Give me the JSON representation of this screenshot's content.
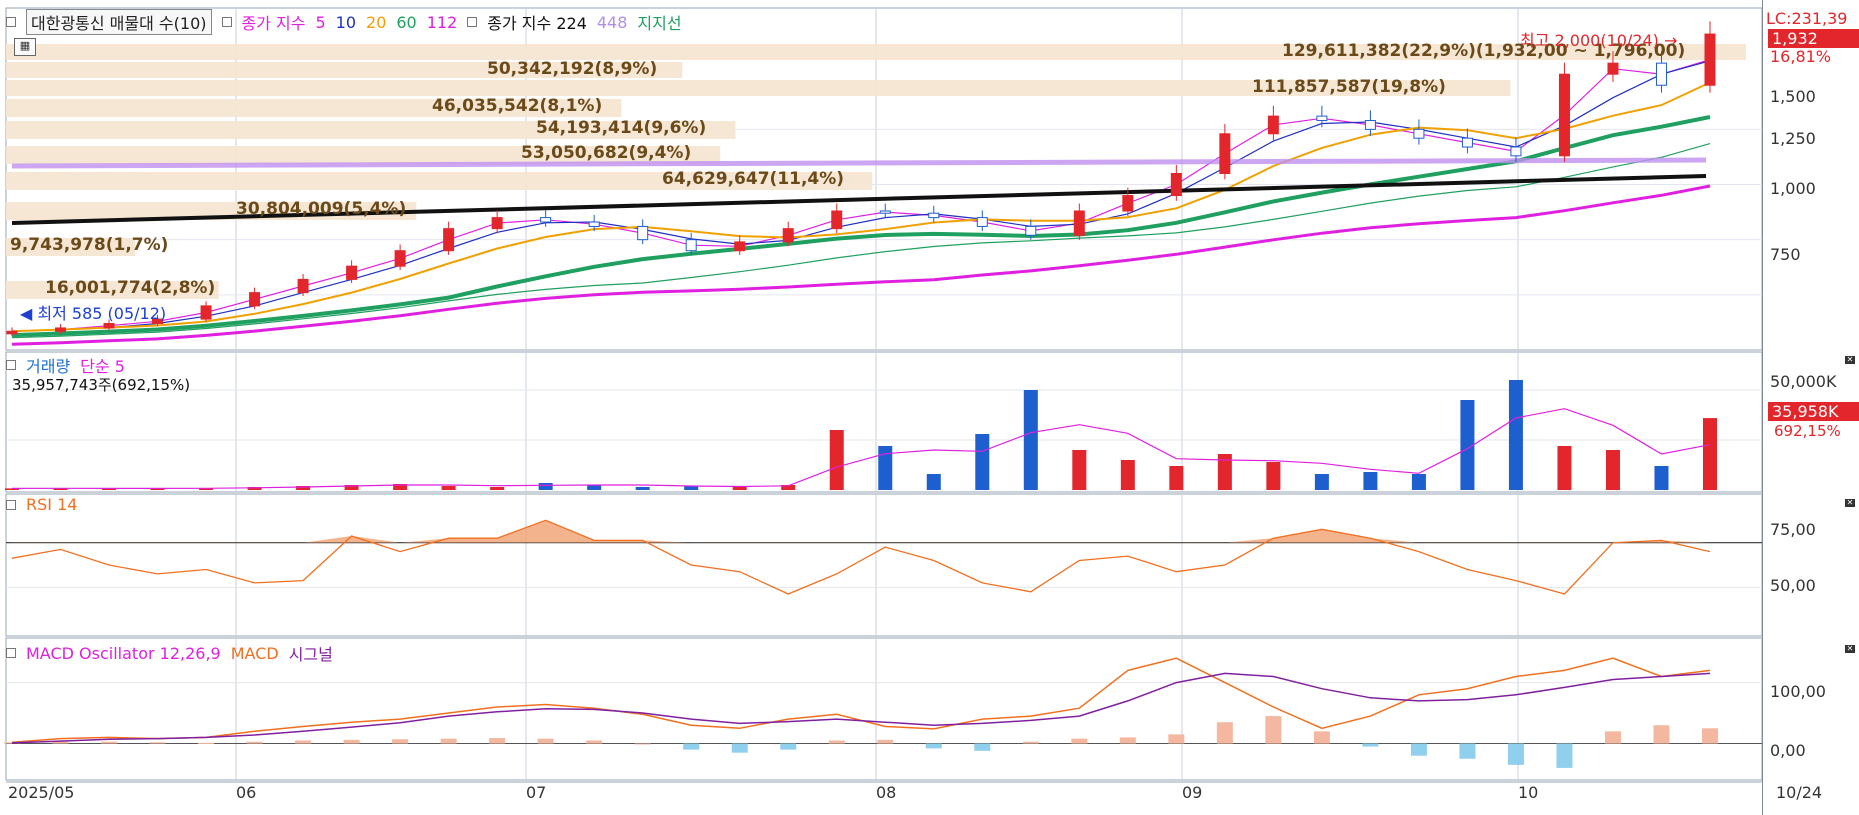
{
  "price_panel": {
    "legend": {
      "title": "대한광통신 매물대 수(10)",
      "ma_label": "종가 지수",
      "ma_periods": [
        "5",
        "10",
        "20",
        "60",
        "112"
      ],
      "ma_colors": [
        "#e020e0",
        "#2030c0",
        "#f0a000",
        "#20a060",
        "#e020e0"
      ],
      "ma2_label": "종가 지수 224",
      "ma2_extra": "448",
      "support_label": "지지선"
    },
    "y_ticks": [
      "1,500",
      "1,250",
      "1,000",
      "750"
    ],
    "last_labels": {
      "lc": "LC:231,39",
      "price": "1,932",
      "pct": "16,81%"
    },
    "annotations": {
      "high": "최고 2,000(10/24)",
      "low": "최저 585 (05/12)",
      "range": "129,611,382(22,9%)(1,932,00 ~ 1,796,00)"
    },
    "volume_profile": [
      {
        "label": "129,611,382(22,9%)(1,932,00 ~ 1,796,00)",
        "value": 129611382,
        "pct": 22.9
      },
      {
        "label": "50,342,192(8,9%)",
        "value": 50342192,
        "pct": 8.9
      },
      {
        "label": "111,857,587(19,8%)",
        "value": 111857587,
        "pct": 19.8
      },
      {
        "label": "46,035,542(8,1%)",
        "value": 46035542,
        "pct": 8.1
      },
      {
        "label": "54,193,414(9,6%)",
        "value": 54193414,
        "pct": 9.6
      },
      {
        "label": "53,050,682(9,4%)",
        "value": 53050682,
        "pct": 9.4
      },
      {
        "label": "64,629,647(11,4%)",
        "value": 64629647,
        "pct": 11.4
      },
      {
        "label": "30,804,009(5,4%)",
        "value": 30804009,
        "pct": 5.4
      },
      {
        "label": "9,743,978(1,7%)",
        "value": 9743978,
        "pct": 1.7
      },
      {
        "label": "16,001,774(2,8%)",
        "value": 16001774,
        "pct": 2.8
      }
    ]
  },
  "volume_panel": {
    "legend": {
      "title": "거래량",
      "ma": "단순 5",
      "readout": "35,957,743주(692,15%)"
    },
    "y_tick": "50,000K",
    "last_tag": "35,958K",
    "last_pct": "692,15%"
  },
  "rsi_panel": {
    "legend": {
      "title": "RSI 14"
    },
    "y_ticks": [
      "75,00",
      "50,00"
    ]
  },
  "macd_panel": {
    "legend": {
      "title": "MACD Oscillator 12,26,9",
      "macd": "MACD",
      "signal": "시그널"
    },
    "y_ticks": [
      "100,00",
      "0,00"
    ]
  },
  "x_axis": {
    "ticks": [
      "2025/05",
      "06",
      "07",
      "08",
      "09",
      "10"
    ],
    "end_label": "10/24"
  },
  "chart_data": [
    {
      "type": "candlestick",
      "title": "대한광통신",
      "x": [
        "2025/05",
        "06",
        "07",
        "08",
        "09",
        "10",
        "10/24"
      ],
      "ylim": [
        585,
        2000
      ],
      "high": {
        "date": "10/24",
        "value": 2000
      },
      "low": {
        "date": "05/12",
        "value": 585
      },
      "last_close": 1932,
      "close_path": [
        585,
        600,
        620,
        640,
        700,
        760,
        820,
        880,
        950,
        1050,
        1100,
        1080,
        1060,
        1000,
        950,
        990,
        1050,
        1130,
        1120,
        1100,
        1060,
        1020,
        1130,
        1200,
        1300,
        1480,
        1560,
        1540,
        1500,
        1460,
        1420,
        1380,
        1750,
        1800,
        1700,
        1932
      ],
      "grid": true
    },
    {
      "type": "bar",
      "title": "거래량",
      "ylabel": "50,000K",
      "values_k": [
        800,
        900,
        700,
        800,
        1000,
        1500,
        2000,
        2500,
        3000,
        2000,
        1500,
        3500,
        2500,
        1500,
        2000,
        1800,
        2500,
        30000,
        22000,
        8000,
        28000,
        50000,
        20000,
        15000,
        12000,
        18000,
        14000,
        8000,
        9000,
        8000,
        45000,
        55000,
        22000,
        20000,
        12000,
        35958
      ],
      "ylim": [
        0,
        55000
      ]
    },
    {
      "type": "line",
      "title": "RSI 14",
      "values": [
        63,
        67,
        60,
        56,
        58,
        52,
        53,
        73,
        66,
        72,
        72,
        80,
        71,
        71,
        60,
        57,
        47,
        56,
        68,
        62,
        52,
        48,
        62,
        64,
        57,
        60,
        72,
        76,
        72,
        66,
        58,
        53,
        47,
        70,
        71,
        66
      ],
      "ylim": [
        30,
        90
      ]
    },
    {
      "type": "line",
      "title": "MACD Oscillator 12,26,9",
      "series": [
        {
          "name": "MACD",
          "color": "#f07020",
          "values": [
            2,
            8,
            10,
            8,
            10,
            20,
            28,
            35,
            40,
            50,
            60,
            64,
            58,
            48,
            30,
            25,
            40,
            48,
            28,
            24,
            40,
            45,
            58,
            120,
            140,
            100,
            60,
            25,
            45,
            80,
            90,
            110,
            120,
            140,
            110,
            120
          ]
        },
        {
          "name": "시그널",
          "color": "#8020a0",
          "values": [
            1,
            4,
            7,
            8,
            10,
            14,
            20,
            27,
            34,
            45,
            52,
            57,
            56,
            50,
            40,
            33,
            36,
            40,
            35,
            30,
            33,
            38,
            45,
            70,
            100,
            115,
            110,
            90,
            75,
            70,
            72,
            80,
            92,
            105,
            110,
            115
          ]
        }
      ],
      "histogram": [
        2,
        3,
        3,
        2,
        1,
        3,
        5,
        6,
        7,
        8,
        9,
        8,
        5,
        0,
        -10,
        -15,
        -10,
        5,
        6,
        -8,
        -12,
        3,
        8,
        10,
        15,
        35,
        45,
        20,
        -5,
        -20,
        -25,
        -35,
        -40,
        20,
        30,
        25
      ],
      "ylim": [
        -50,
        160
      ]
    }
  ]
}
